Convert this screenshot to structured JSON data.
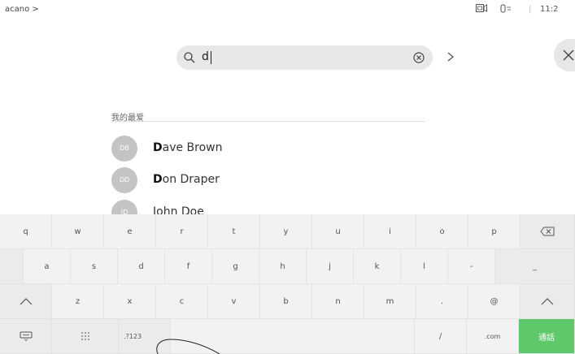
{
  "header": {
    "breadcrumb": "acano >",
    "time": "11:2"
  },
  "search": {
    "value": "d"
  },
  "favorites": {
    "title": "我的最爱",
    "contacts": [
      {
        "initials": "DB",
        "match": "D",
        "rest": "ave Brown"
      },
      {
        "initials": "DD",
        "match": "D",
        "rest": "on Draper"
      },
      {
        "initials": "JD",
        "match": "",
        "rest": "John Doe"
      }
    ]
  },
  "keyboard": {
    "row1": [
      "q",
      "w",
      "e",
      "r",
      "t",
      "y",
      "u",
      "i",
      "o",
      "p"
    ],
    "row2": [
      "a",
      "s",
      "d",
      "f",
      "g",
      "h",
      "j",
      "k",
      "l",
      "-",
      "_"
    ],
    "row3": [
      "z",
      "x",
      "c",
      "v",
      "b",
      "n",
      "m",
      ".",
      "@"
    ],
    "row4": [
      ".?123",
      "/",
      ".com",
      "通話"
    ]
  },
  "colors": {
    "accent_green": "#5ec86a",
    "search_bg": "#e8e8e8",
    "keyboard_bg": "#f2f2f2"
  }
}
